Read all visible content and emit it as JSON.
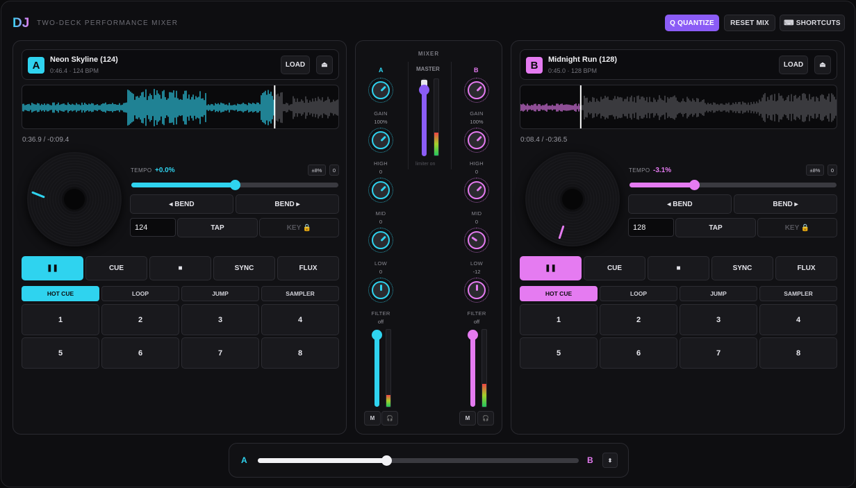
{
  "header": {
    "logo": "DJ",
    "subtitle": "TWO-DECK PERFORMANCE MIXER",
    "quantize_label": "Q QUANTIZE",
    "reset_label": "RESET MIX",
    "shortcuts_label": "⌨ SHORTCUTS"
  },
  "colors": {
    "deck_a": "#2fd3ef",
    "deck_b": "#e57bf1",
    "master": "#8b5cf6"
  },
  "deck_a": {
    "letter": "A",
    "title": "Neon Skyline (124)",
    "meta": "0:46.4 · 124 BPM",
    "load_label": "LOAD",
    "eject_label": "⏏",
    "time": "0:36.9 / -0:09.4",
    "playhead_pct": 79.5,
    "tempo_label": "TEMPO",
    "tempo_value": "+0.0%",
    "tempo_fraction": 0.5,
    "range_label": "±8%",
    "reset_tempo": "0",
    "bend_down": "◂ BEND",
    "bend_up": "BEND ▸",
    "bpm_value": "124",
    "tap_label": "TAP",
    "key_label": "KEY 🔒",
    "transport": [
      "❚❚",
      "CUE",
      "■",
      "SYNC",
      "FLUX"
    ],
    "modes": [
      "HOT CUE",
      "LOOP",
      "JUMP",
      "SAMPLER"
    ],
    "pads": [
      "1",
      "2",
      "3",
      "4",
      "5",
      "6",
      "7",
      "8"
    ]
  },
  "deck_b": {
    "letter": "B",
    "title": "Midnight Run (128)",
    "meta": "0:45.0 · 128 BPM",
    "load_label": "LOAD",
    "eject_label": "⏏",
    "time": "0:08.4 / -0:36.5",
    "playhead_pct": 19,
    "tempo_label": "TEMPO",
    "tempo_value": "-3.1%",
    "tempo_fraction": 0.31,
    "range_label": "±8%",
    "reset_tempo": "0",
    "bend_down": "◂ BEND",
    "bend_up": "BEND ▸",
    "bpm_value": "128",
    "tap_label": "TAP",
    "key_label": "KEY 🔒",
    "transport": [
      "❚❚",
      "CUE",
      "■",
      "SYNC",
      "FLUX"
    ],
    "modes": [
      "HOT CUE",
      "LOOP",
      "JUMP",
      "SAMPLER"
    ],
    "pads": [
      "1",
      "2",
      "3",
      "4",
      "5",
      "6",
      "7",
      "8"
    ]
  },
  "mixer": {
    "title": "MIXER",
    "a_label": "A",
    "b_label": "B",
    "master_label": "MASTER",
    "limiter_label": "limiter on",
    "master_level": 0.85,
    "master_vu": 0.25,
    "a_knobs": [
      {
        "label": "GAIN",
        "value": "100%"
      },
      {
        "label": "HIGH",
        "value": "0"
      },
      {
        "label": "MID",
        "value": "0"
      },
      {
        "label": "LOW",
        "value": "0"
      },
      {
        "label": "FILTER",
        "value": "off"
      }
    ],
    "b_knobs": [
      {
        "label": "GAIN",
        "value": "100%"
      },
      {
        "label": "HIGH",
        "value": "0"
      },
      {
        "label": "MID",
        "value": "0"
      },
      {
        "label": "LOW",
        "value": "-12"
      },
      {
        "label": "FILTER",
        "value": "off"
      }
    ],
    "a_fader": 0.95,
    "b_fader": 0.95,
    "a_vu": 0.15,
    "b_vu": 0.3,
    "mute_label": "M",
    "cue_label": "🎧"
  },
  "crossfader": {
    "a_label": "A",
    "b_label": "B",
    "position": 0.4,
    "options_icon": "⬍"
  }
}
